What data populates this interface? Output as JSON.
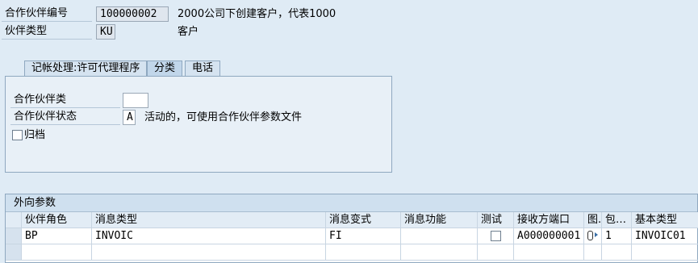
{
  "header": {
    "partner_no_label": "合作伙伴编号",
    "partner_no_value": "100000002",
    "partner_no_desc": "2000公司下创建客户，代表1000",
    "partner_type_label": "伙伴类型",
    "partner_type_value": "KU",
    "partner_type_desc": "客户"
  },
  "tabs": [
    {
      "label": "记帐处理:许可代理程序"
    },
    {
      "label": "分类"
    },
    {
      "label": "电话"
    }
  ],
  "panel": {
    "partner_class_label": "合作伙伴类",
    "partner_class_value": "",
    "partner_status_label": "合作伙伴状态",
    "partner_status_value": "A",
    "partner_status_desc": "活动的，可使用合作伙伴参数文件",
    "archive_label": "归档"
  },
  "outbound": {
    "title": "外向参数",
    "columns": [
      "伙伴角色",
      "消息类型",
      "消息变式",
      "消息功能",
      "测试",
      "接收方端口",
      "图.",
      "包…",
      "基本类型"
    ],
    "rows": [
      {
        "role": "BP",
        "msg_type": "INVOIC",
        "variant": "FI",
        "function": "",
        "test": false,
        "port": "A000000001",
        "icon": "",
        "pack": "1",
        "basic_type": "INVOIC01"
      }
    ]
  }
}
